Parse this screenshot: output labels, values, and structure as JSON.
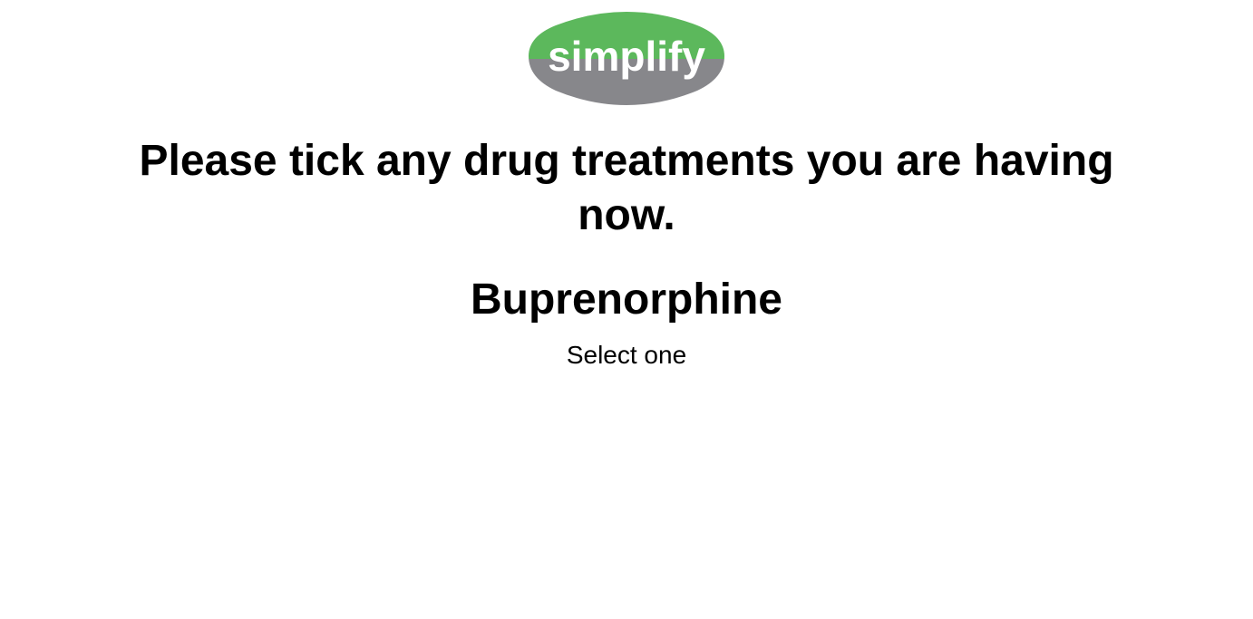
{
  "logo": {
    "text": "simplify",
    "colors": {
      "top": "#5cb85c",
      "bottom": "#87878b",
      "text": "#ffffff"
    }
  },
  "question": {
    "text": "Please tick any drug treatments you are having now."
  },
  "drug": {
    "name": "Buprenorphine"
  },
  "instruction": {
    "text": "Select one"
  }
}
